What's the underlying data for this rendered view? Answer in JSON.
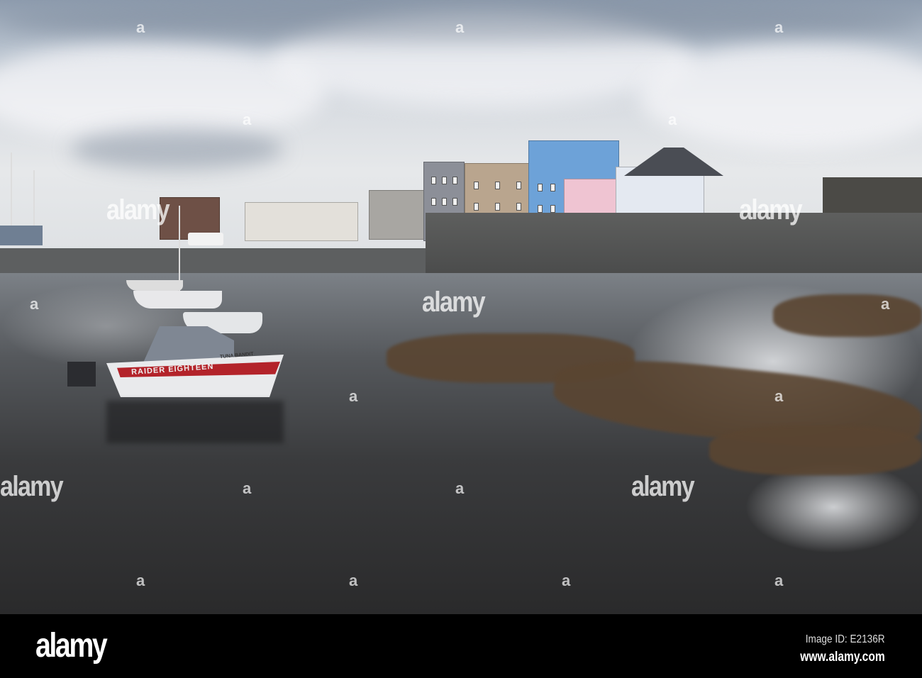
{
  "watermark": {
    "logo": "alamy",
    "letter": "a"
  },
  "boat": {
    "name": "RAIDER EIGHTEEN",
    "second_name": "TUNA BANDIT"
  },
  "footer": {
    "logo": "alamy",
    "image_id": "Image ID: E2136R",
    "website": "www.alamy.com"
  },
  "colors": {
    "sky": "#d9dde2",
    "water": "#3a3b3d",
    "hull_stripe": "#b3232a",
    "footer_bg": "#000000"
  }
}
